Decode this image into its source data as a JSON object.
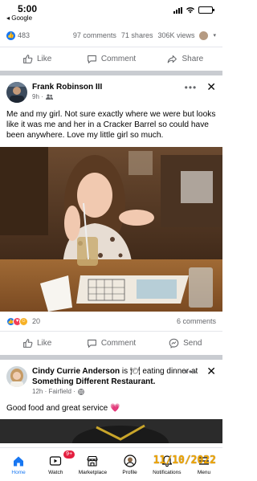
{
  "status_bar": {
    "time": "5:00",
    "back_label": "◂ Google",
    "battery_level": 0.8
  },
  "prev_post": {
    "likes": "483",
    "comments": "97 comments",
    "shares": "71 shares",
    "views": "306K views",
    "actions": {
      "like": "Like",
      "comment": "Comment",
      "share": "Share"
    }
  },
  "post": {
    "author": "Frank Robinson III",
    "time": "9h ·",
    "text": "Me and my girl. Not sure exactly where we were but looks like it was me and her in a Cracker Barrel so could have been anywhere. Love my little girl so much.",
    "reactions_count": "20",
    "comments_count": "6 comments",
    "actions": {
      "like": "Like",
      "comment": "Comment",
      "send": "Send"
    }
  },
  "post2": {
    "author": "Cindy Currie Anderson",
    "status_pre": "is",
    "status_emoji": "🍽",
    "status_mid": "eating dinner at",
    "place": "Something Different Restaurant.",
    "time": "12h · Fairfield ·",
    "text": "Good food and great service",
    "emoji": "💗"
  },
  "nav": {
    "home": "Home",
    "watch": "Watch",
    "watch_badge": "9+",
    "marketplace": "Marketplace",
    "profile": "Profile",
    "notifications": "Notifications",
    "menu": "Menu"
  },
  "photo_timestamp": "11/10/2022",
  "colors": {
    "accent": "#1877f2",
    "badge": "#e41e3f",
    "timestamp": "#f0a500"
  }
}
